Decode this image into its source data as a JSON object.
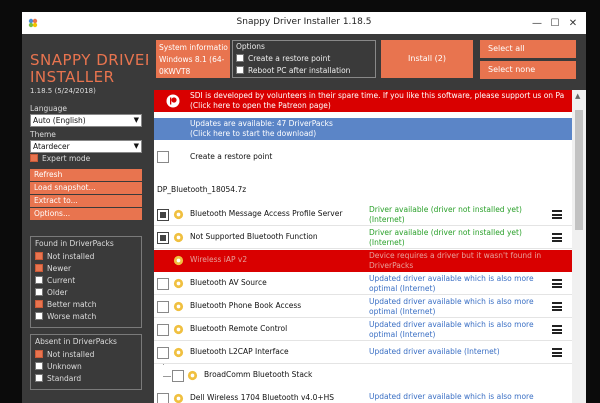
{
  "window": {
    "title": "Snappy Driver Installer 1.18.5",
    "minimize": "—",
    "maximize": "☐",
    "close": "✕"
  },
  "sidebar": {
    "logo_line1": "SNAPPY DRIVER",
    "logo_line2": "INSTALLER",
    "version": "1.18.5 (5/24/2018)",
    "language_label": "Language",
    "language_value": "Auto (English)",
    "theme_label": "Theme",
    "theme_value": "Atardecer",
    "expert_mode": "Expert mode",
    "actions": [
      "Refresh",
      "Load snapshot...",
      "Extract to...",
      "Options..."
    ],
    "found_title": "Found in DriverPacks",
    "found_items": [
      {
        "label": "Not installed",
        "checked": true
      },
      {
        "label": "Newer",
        "checked": true
      },
      {
        "label": "Current",
        "checked": false
      },
      {
        "label": "Older",
        "checked": false
      },
      {
        "label": "Better match",
        "checked": true
      },
      {
        "label": "Worse match",
        "checked": false
      }
    ],
    "absent_title": "Absent in DriverPacks",
    "absent_items": [
      {
        "label": "Not installed",
        "checked": true
      },
      {
        "label": "Unknown",
        "checked": false
      },
      {
        "label": "Standard",
        "checked": false
      }
    ]
  },
  "toolbar": {
    "sysinfo_line1": "System informatio",
    "sysinfo_line2": "Windows 8.1 (64-",
    "sysinfo_line3": "0KWVT8",
    "options_title": "Options",
    "option_restore": "Create a restore point",
    "option_reboot": "Reboot PC after installation",
    "install": "Install (2)",
    "select_all": "Select all",
    "select_none": "Select none"
  },
  "main": {
    "patreon_line1": "SDI is developed by volunteers in their spare time. If you like this software, please support us on Pa",
    "patreon_line2": "(Click here to open the Patreon page)",
    "updates_line1": "Updates are available: 47 DriverPacks",
    "updates_line2": "(Click here to start the download)",
    "restore_point": "Create a restore point",
    "pack_name": "DP_Bluetooth_18054.7z",
    "rows": [
      {
        "name": "Bluetooth Message Access Profile Server",
        "status1": "Driver available (driver not installed yet)",
        "status2": "(Internet)"
      },
      {
        "name": "Not Supported Bluetooth Function",
        "status1": "Driver available (driver not installed yet)",
        "status2": "(Internet)"
      },
      {
        "name": "Wireless iAP v2",
        "status1": "Device requires a driver but it wasn't found in",
        "status2": "DriverPacks"
      },
      {
        "name": "Bluetooth AV Source",
        "status1": "Updated driver available which is also more",
        "status2": "optimal (Internet)"
      },
      {
        "name": "Bluetooth Phone Book Access",
        "status1": "Updated driver available which is also more",
        "status2": "optimal (Internet)"
      },
      {
        "name": "Bluetooth Remote Control",
        "status1": "Updated driver available which is also more",
        "status2": "optimal (Internet)"
      },
      {
        "name": "Bluetooth L2CAP Interface",
        "status1": "Updated driver available (Internet)",
        "status2": ""
      },
      {
        "name": "BroadComm Bluetooth Stack",
        "status1": "",
        "status2": ""
      },
      {
        "name": "Dell Wireless 1704 Bluetooth v4.0+HS",
        "status1": "Updated driver available which is also more",
        "status2": ""
      }
    ]
  },
  "colors": {
    "accent": "#e8744f",
    "panel": "#3a3a3a",
    "banner_red": "#d90000",
    "banner_blue": "#5b85c7",
    "status_green": "#2aa02a"
  }
}
